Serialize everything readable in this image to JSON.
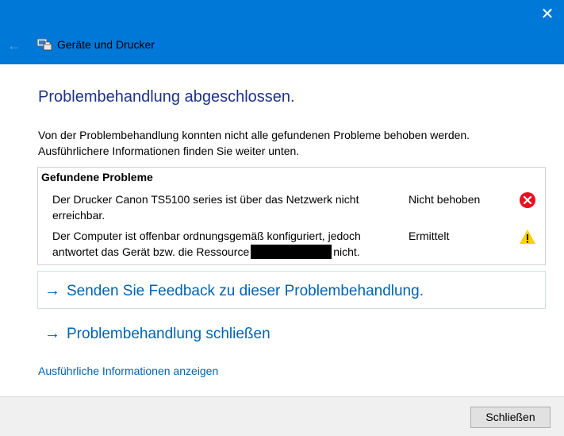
{
  "window": {
    "title": "Geräte und Drucker",
    "back_icon": "arrow-left-icon",
    "close_icon": "close-icon",
    "app_icon": "devices-printers-icon"
  },
  "main": {
    "heading": "Problembehandlung abgeschlossen.",
    "intro_line1": "Von der Problembehandlung konnten nicht alle gefundenen Probleme behoben werden.",
    "intro_line2": "Ausführlichere Informationen finden Sie weiter unten."
  },
  "problems": {
    "title": "Gefundene Probleme",
    "items": [
      {
        "line1": "Der Drucker Canon TS5100 series ist über das Netzwerk nicht",
        "line2": "erreichbar.",
        "status": "Nicht behoben",
        "icon": "error-icon",
        "icon_color": "#e81123"
      },
      {
        "line1": "Der Computer ist offenbar ordnungsgemäß konfiguriert, jedoch",
        "line2_prefix": "antwortet das Gerät bzw. die Ressource",
        "line2_suffix": "nicht.",
        "status": "Ermittelt",
        "icon": "warning-icon",
        "icon_color": "#ffd100"
      }
    ]
  },
  "actions": {
    "feedback_link": "Senden Sie Feedback zu dieser Problembehandlung.",
    "close_troubleshooting_link": "Problembehandlung schließen",
    "details_link": "Ausführliche Informationen anzeigen",
    "close_button": "Schließen"
  },
  "colors": {
    "titlebar": "#0078d7",
    "heading": "#1e3287",
    "link": "#0063b1"
  }
}
